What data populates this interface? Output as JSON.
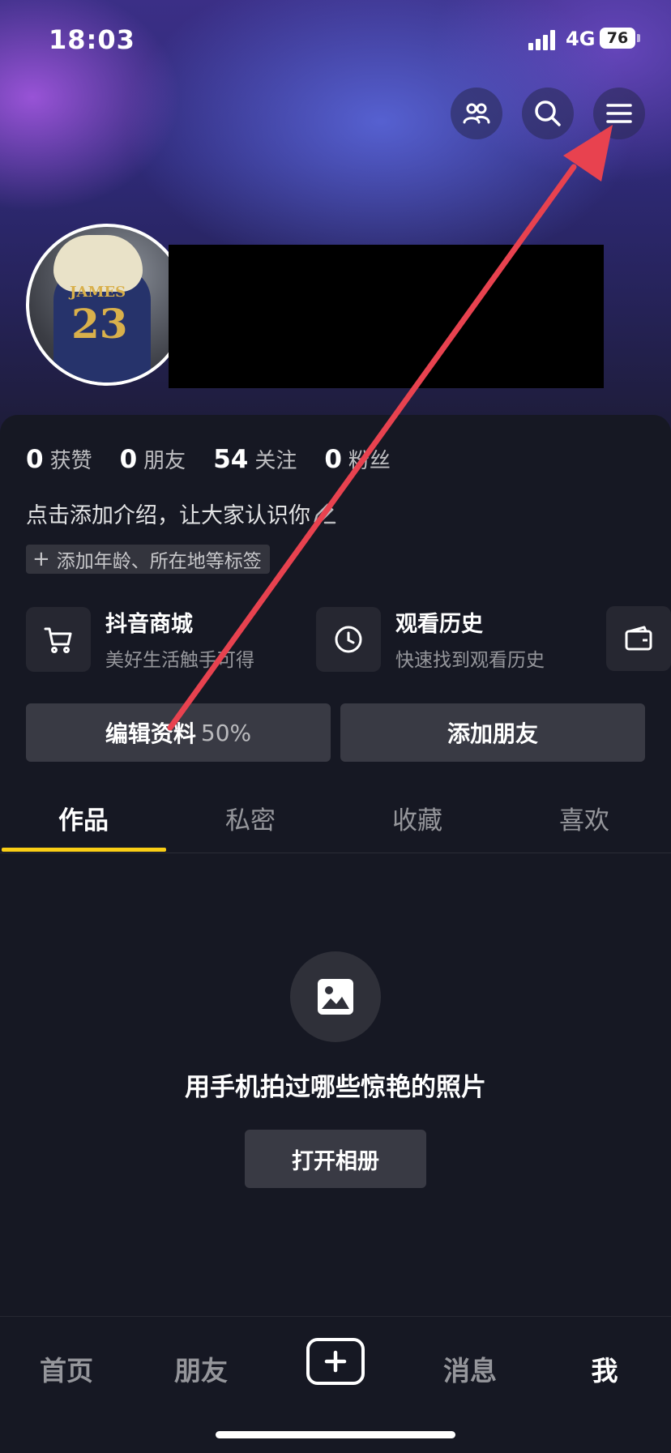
{
  "status_bar": {
    "time": "18:03",
    "network": "4G",
    "battery": "76"
  },
  "header": {
    "icons": [
      "friends-icon",
      "search-icon",
      "menu-icon"
    ],
    "avatar": {
      "jersey_name": "JAMES",
      "jersey_number": "23"
    }
  },
  "stats": [
    {
      "value": "0",
      "label": "获赞"
    },
    {
      "value": "0",
      "label": "朋友"
    },
    {
      "value": "54",
      "label": "关注"
    },
    {
      "value": "0",
      "label": "粉丝"
    }
  ],
  "bio": {
    "placeholder": "点击添加介绍，让大家认识你",
    "tag_label": "添加年龄、所在地等标签",
    "tag_icon": "+"
  },
  "shortcuts": [
    {
      "title": "抖音商城",
      "subtitle": "美好生活触手可得",
      "icon": "cart-icon"
    },
    {
      "title": "观看历史",
      "subtitle": "快速找到观看历史",
      "icon": "clock-icon"
    },
    {
      "title": "",
      "subtitle": "",
      "icon": "wallet-icon"
    }
  ],
  "actions": {
    "edit_profile": "编辑资料",
    "edit_progress": "50%",
    "add_friend": "添加朋友"
  },
  "tabs": [
    "作品",
    "私密",
    "收藏",
    "喜欢"
  ],
  "active_tab": "作品",
  "empty_state": {
    "icon": "image-icon",
    "text": "用手机拍过哪些惊艳的照片",
    "button": "打开相册"
  },
  "bottom_nav": {
    "home": "首页",
    "friends": "朋友",
    "create_icon": "plus-icon",
    "messages": "消息",
    "me": "我"
  },
  "colors": {
    "accent": "#face15",
    "background": "#161823",
    "annotation_arrow": "#e8424f"
  }
}
